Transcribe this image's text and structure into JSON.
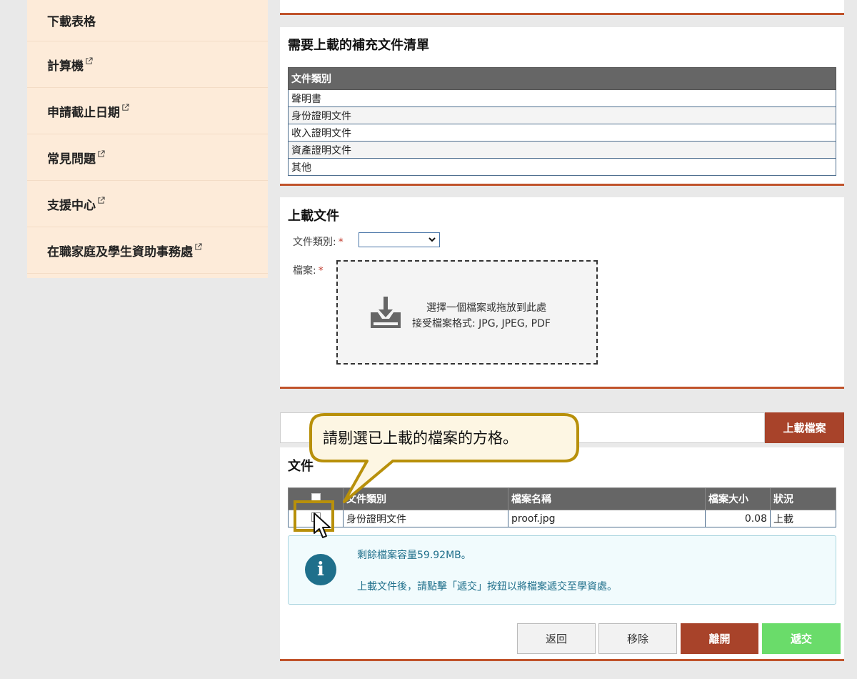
{
  "sidebar": {
    "items": [
      {
        "label": "下載表格",
        "external": false
      },
      {
        "label": "計算機",
        "external": true
      },
      {
        "label": "申請截止日期",
        "external": true
      },
      {
        "label": "常見問題",
        "external": true
      },
      {
        "label": "支援中心",
        "external": true
      },
      {
        "label": "在職家庭及學生資助事務處",
        "external": true
      }
    ]
  },
  "checklist": {
    "title": "需要上載的補充文件清單",
    "header": "文件類別",
    "rows": [
      "聲明書",
      "身份證明文件",
      "收入證明文件",
      "資產證明文件",
      "其他"
    ]
  },
  "upload": {
    "title": "上載文件",
    "category_label": "文件類別:",
    "file_label": "檔案:",
    "required_mark": "*",
    "category_value": "",
    "dropzone_line1": "選擇一個檔案或拖放到此處",
    "dropzone_line2": "接受檔案格式: JPG, JPEG, PDF",
    "upload_button": "上載檔案"
  },
  "files": {
    "title": "文件",
    "columns": [
      "文件類別",
      "檔案名稱",
      "檔案大小",
      "狀況"
    ],
    "rows": [
      {
        "category": "身份證明文件",
        "filename": "proof.jpg",
        "size": "0.08",
        "status": "上載",
        "checked": false
      }
    ],
    "info_line1": "剩餘檔案容量59.92MB。",
    "info_line2": "上載文件後，請點擊「遞交」按鈕以將檔案遞交至學資處。"
  },
  "buttons": {
    "back": "返回",
    "remove": "移除",
    "leave": "離開",
    "submit": "遞交"
  },
  "tooltip": {
    "text": "請剔選已上載的檔案的方格。"
  },
  "colors": {
    "accent": "#c0532b",
    "danger_button": "#a8432a",
    "submit_button": "#6adc6a",
    "callout_border": "#b8900a",
    "callout_fill": "#fdf6e3",
    "info_color": "#1f6f8b"
  }
}
